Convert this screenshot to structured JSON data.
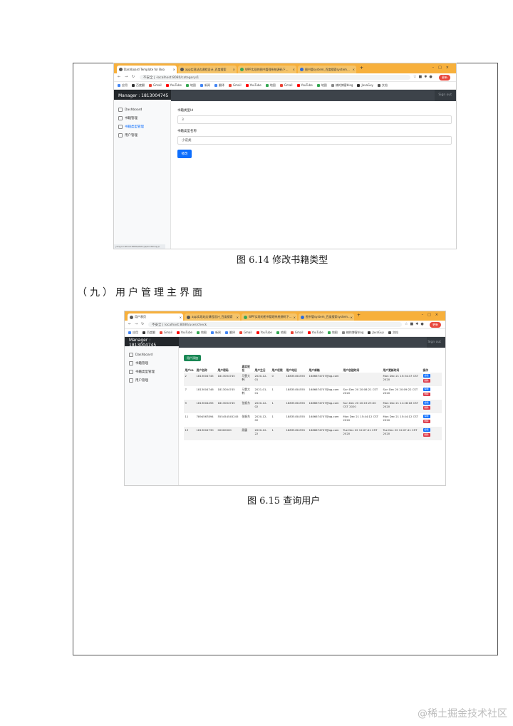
{
  "shot1": {
    "tabs": [
      {
        "label": "Dashboard Template for Boo"
      },
      {
        "label": "app实现站边课程设计_百度搜索"
      },
      {
        "label": "WPF实现的图书管理系统源码下..."
      },
      {
        "label": "图书管system_百度搜索system..."
      }
    ],
    "url": "不安全 | ·localhost:8080/category/1",
    "update_label": "更新",
    "bookmarks": [
      "应用",
      "百度翻",
      "Gmail",
      "YouTube",
      "地图",
      "新闻",
      "翻译",
      "Gmail",
      "YouTube",
      "地图",
      "Gmail",
      "YouTube",
      "地图",
      "楠的博客blog",
      "JavaGuy",
      "文档"
    ],
    "brand": "Manager : 1813004745",
    "signout": "Sign out",
    "sidebar": [
      "Dashboard",
      "书籍管理",
      "书籍类型管理",
      "用户管理"
    ],
    "field1_label": "书籍类型Id",
    "field1_value": "3",
    "field2_label": "书籍类型名称",
    "field2_value": "小说类",
    "submit_label": "修改",
    "status_url": "yang.localhost:8080/static/js/bootstrap.js"
  },
  "caption1": "图 6.14 修改书籍类型",
  "section_heading": "（九）用户管理主界面",
  "shot2": {
    "tabs": [
      {
        "label": "用户表页"
      },
      {
        "label": "app实现站边课程设计_百度搜索"
      },
      {
        "label": "WPF实现的图书管理系统源码下..."
      },
      {
        "label": "图书管system_百度搜索system..."
      }
    ],
    "url": "不安全 | localhost:8080/user/check",
    "update_label": "更新",
    "bookmarks": [
      "应用",
      "百度翻",
      "Gmail",
      "YouTube",
      "地图",
      "新闻",
      "翻译",
      "Gmail",
      "YouTube",
      "地图",
      "Gmail",
      "YouTube",
      "地图",
      "楠的博客blog",
      "JavaGuy",
      "文档"
    ],
    "brand": "Manager : 1813004745",
    "signout": "Sign out",
    "sidebar": [
      "Dashboard",
      "书籍管理",
      "书籍类型管理",
      "用户管理"
    ],
    "add_button": "用户添加",
    "table": {
      "headers": [
        "用户ID",
        "用户名称",
        "用户密码",
        "真实姓名",
        "用户生日",
        "用户权限",
        "用户电话",
        "用户邮箱",
        "用户创建时间",
        "用户更新时间",
        "操作"
      ],
      "rows": [
        [
          "2",
          "1813004745",
          "1813004745",
          "马赞大韩",
          "2020-12-01",
          "0",
          "18835454555",
          "1686674707@qq.com",
          "",
          "Mon Dec 21 15:34:47 CST 2020"
        ],
        [
          "7",
          "1813004746",
          "1813004745",
          "马赞大韩",
          "2021-01-01",
          "1",
          "18835454555",
          "1686674707@qq.com",
          "Sun Dec 20 20:08:21 CST 2020",
          "Sun Dec 20 20:09:22 CST 2020"
        ],
        [
          "9",
          "1813004455",
          "1813004745",
          "张振东",
          "2020-12-02",
          "1",
          "18835454555",
          "1686674707@qq.com",
          "Sun Dec 20 20:19:23:00 CST 2020",
          "Mon Dec 21 11:28:18 CST 2020"
        ],
        [
          "11",
          "7894567894",
          "555454545245",
          "张振东",
          "2020-12-02",
          "1",
          "18835454555",
          "1686674707@qq.com",
          "Mon Dec 21 15:44:12 CST 2020",
          "Mon Dec 21 15:44:12 CST 2020"
        ],
        [
          "13",
          "1813004730",
          "00000000",
          "顾震",
          "2020-12-22",
          "1",
          "18835454555",
          "1686674707@qq.com",
          "Tue Dec 22 12:07:41 CST 2020",
          "Tue Dec 22 12:07:41 CST 2020"
        ]
      ],
      "edit_label": "编辑",
      "delete_label": "删除"
    }
  },
  "caption2": "图 6.15 查询用户",
  "watermark": "@稀土掘金技术社区"
}
